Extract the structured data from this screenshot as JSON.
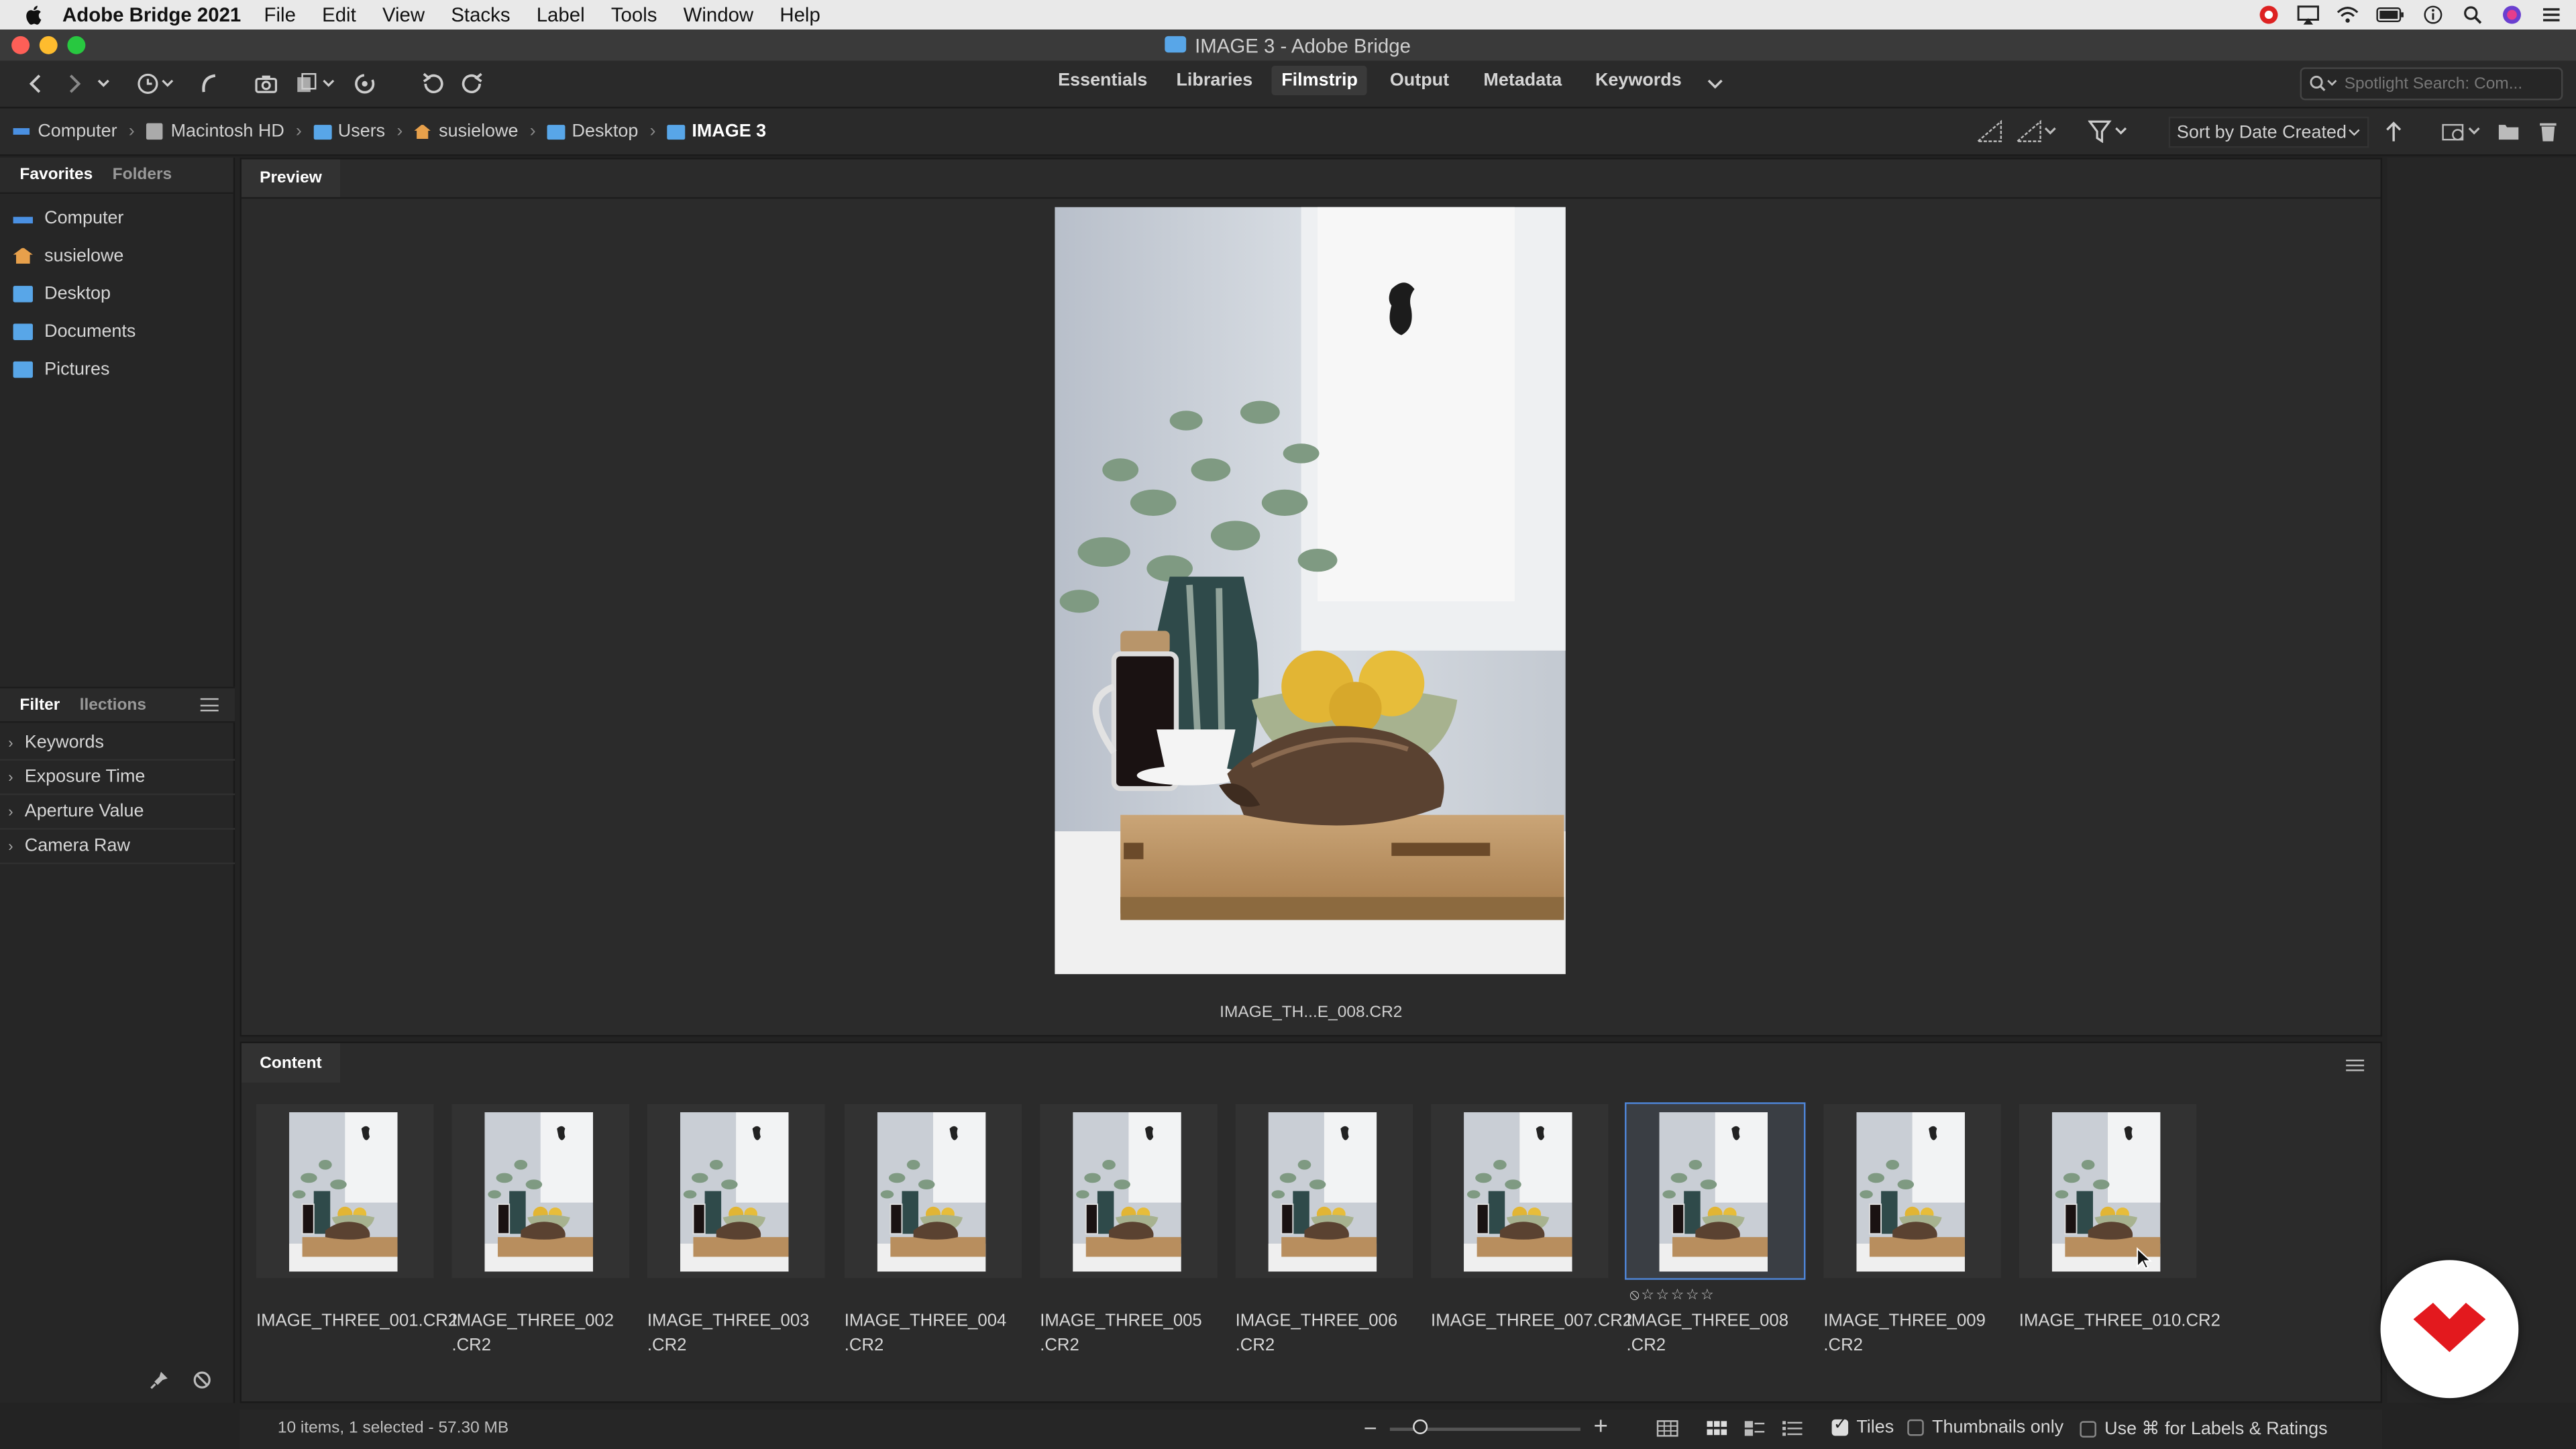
{
  "menubar": {
    "app_name": "Adobe Bridge 2021",
    "items": [
      "File",
      "Edit",
      "View",
      "Stacks",
      "Label",
      "Tools",
      "Window",
      "Help"
    ]
  },
  "window": {
    "title": "IMAGE 3 - Adobe Bridge"
  },
  "workspaces": {
    "items": [
      "Essentials",
      "Libraries",
      "Filmstrip",
      "Output",
      "Metadata",
      "Keywords"
    ],
    "active": "Filmstrip"
  },
  "search": {
    "placeholder": "Spotlight Search: Com..."
  },
  "path": {
    "crumbs": [
      "Computer",
      "Macintosh HD",
      "Users",
      "susielowe",
      "Desktop",
      "IMAGE 3"
    ]
  },
  "sort": {
    "label": "Sort by Date Created"
  },
  "left_panel": {
    "tabs": [
      "Favorites",
      "Folders"
    ],
    "favorites": [
      "Computer",
      "susielowe",
      "Desktop",
      "Documents",
      "Pictures"
    ],
    "filter_tabs": [
      "Filter",
      "llections"
    ],
    "filters": [
      "Keywords",
      "Exposure Time",
      "Aperture Value",
      "Camera Raw"
    ]
  },
  "preview": {
    "tab": "Preview",
    "caption": "IMAGE_TH...E_008.CR2"
  },
  "content": {
    "tab": "Content",
    "items": [
      {
        "line1": "IMAGE_THREE_001.CR2",
        "line2": ""
      },
      {
        "line1": "IMAGE_THREE_002",
        "line2": ".CR2"
      },
      {
        "line1": "IMAGE_THREE_003",
        "line2": ".CR2"
      },
      {
        "line1": "IMAGE_THREE_004",
        "line2": ".CR2"
      },
      {
        "line1": "IMAGE_THREE_005",
        "line2": ".CR2"
      },
      {
        "line1": "IMAGE_THREE_006",
        "line2": ".CR2"
      },
      {
        "line1": "IMAGE_THREE_007.CR2",
        "line2": ""
      },
      {
        "line1": "IMAGE_THREE_008",
        "line2": ".CR2"
      },
      {
        "line1": "IMAGE_THREE_009",
        "line2": ".CR2"
      },
      {
        "line1": "IMAGE_THREE_010.CR2",
        "line2": ""
      }
    ],
    "selected_index": 7,
    "rating_text": "⦸☆☆☆☆☆"
  },
  "status": {
    "summary": "10 items, 1 selected - 57.30 MB",
    "tiles_label": "Tiles",
    "tiles_checked": true,
    "thumbs_only_label": "Thumbnails only",
    "labels_ratings_label": "Use ⌘ for Labels & Ratings"
  },
  "colors": {
    "accent": "#2f7ad6",
    "folder": "#58a6e8",
    "badge_red": "#e3191e"
  }
}
